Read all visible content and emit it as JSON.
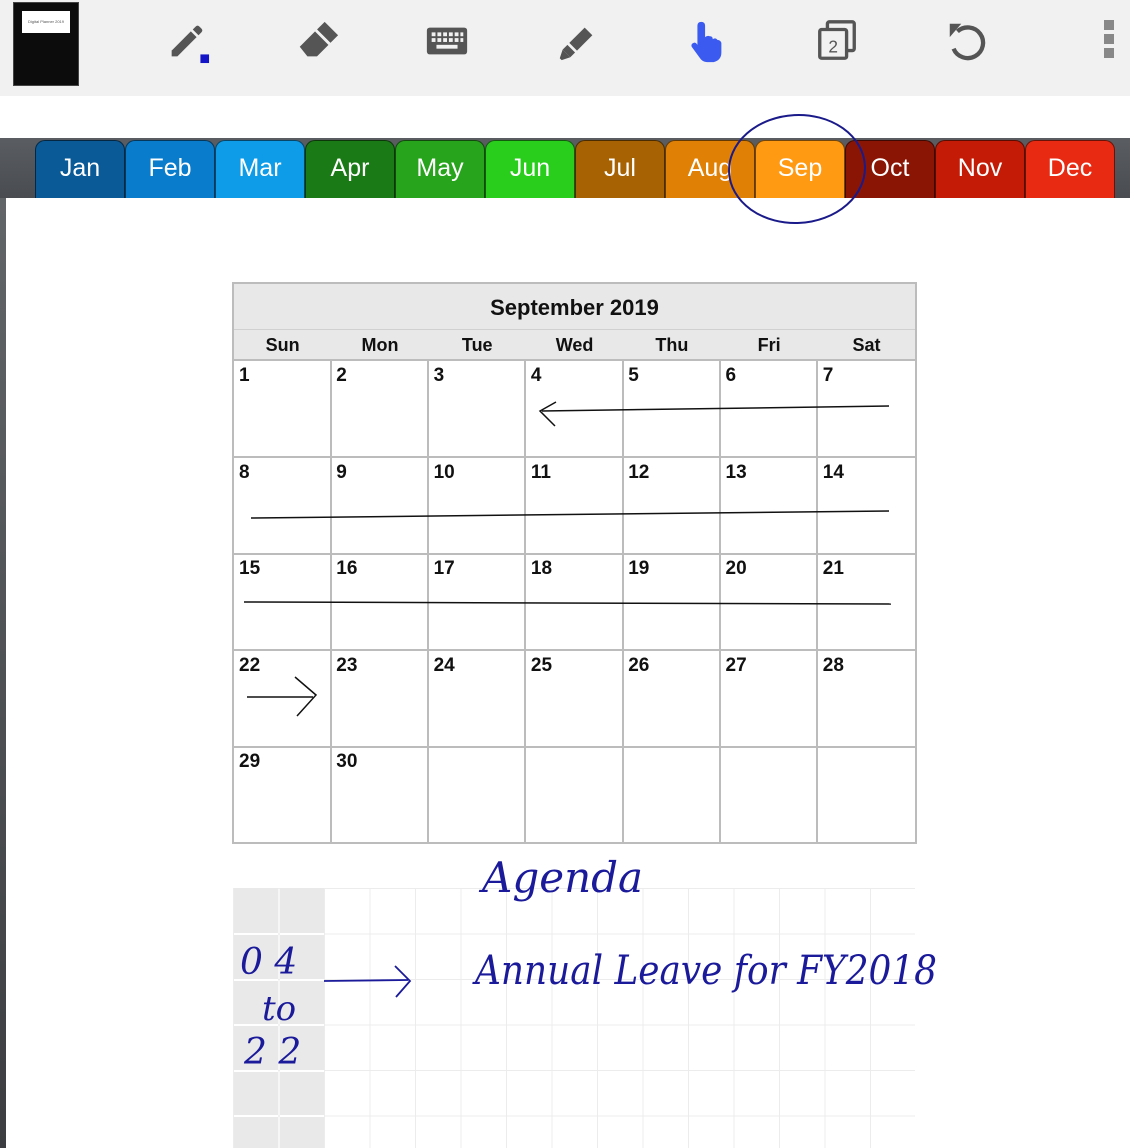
{
  "toolbar": {
    "notebook_label": "Digital Planner 2019",
    "tools": [
      {
        "icon": "pen-icon",
        "color": "#555555",
        "accent": "#1515c8"
      },
      {
        "icon": "eraser-icon",
        "color": "#555555"
      },
      {
        "icon": "keyboard-icon",
        "color": "#555555"
      },
      {
        "icon": "highlighter-icon",
        "color": "#555555"
      },
      {
        "icon": "hand-pointer-icon",
        "color": "#3b5bf0"
      },
      {
        "icon": "page-copies-icon",
        "color": "#555555",
        "badge": "2"
      },
      {
        "icon": "undo-icon",
        "color": "#555555"
      },
      {
        "icon": "more-vert-icon",
        "color": "#888888"
      }
    ]
  },
  "months": [
    {
      "label": "Jan",
      "color": "#0a5a98"
    },
    {
      "label": "Feb",
      "color": "#0a7ccc"
    },
    {
      "label": "Mar",
      "color": "#0e9ce9"
    },
    {
      "label": "Apr",
      "color": "#1a7a15"
    },
    {
      "label": "May",
      "color": "#27a41c"
    },
    {
      "label": "Jun",
      "color": "#29ce1d"
    },
    {
      "label": "Jul",
      "color": "#a66203"
    },
    {
      "label": "Aug",
      "color": "#e08005"
    },
    {
      "label": "Sep",
      "color": "#ff9a12",
      "selected": true
    },
    {
      "label": "Oct",
      "color": "#8a1505"
    },
    {
      "label": "Nov",
      "color": "#c41b06"
    },
    {
      "label": "Dec",
      "color": "#e82a12"
    }
  ],
  "calendar": {
    "title": "September 2019",
    "weekdays": [
      "Sun",
      "Mon",
      "Tue",
      "Wed",
      "Thu",
      "Fri",
      "Sat"
    ],
    "weeks": [
      [
        "1",
        "2",
        "3",
        "4",
        "5",
        "6",
        "7"
      ],
      [
        "8",
        "9",
        "10",
        "11",
        "12",
        "13",
        "14"
      ],
      [
        "15",
        "16",
        "17",
        "18",
        "19",
        "20",
        "21"
      ],
      [
        "22",
        "23",
        "24",
        "25",
        "26",
        "27",
        "28"
      ],
      [
        "29",
        "30",
        "",
        "",
        "",
        "",
        ""
      ]
    ]
  },
  "handwriting": {
    "heading": "Agenda",
    "date_from": "0 4",
    "date_to_word": "to",
    "date_to": "2 2",
    "note": "Annual Leave for FY2018",
    "ink_color": "#1a1a9a"
  }
}
